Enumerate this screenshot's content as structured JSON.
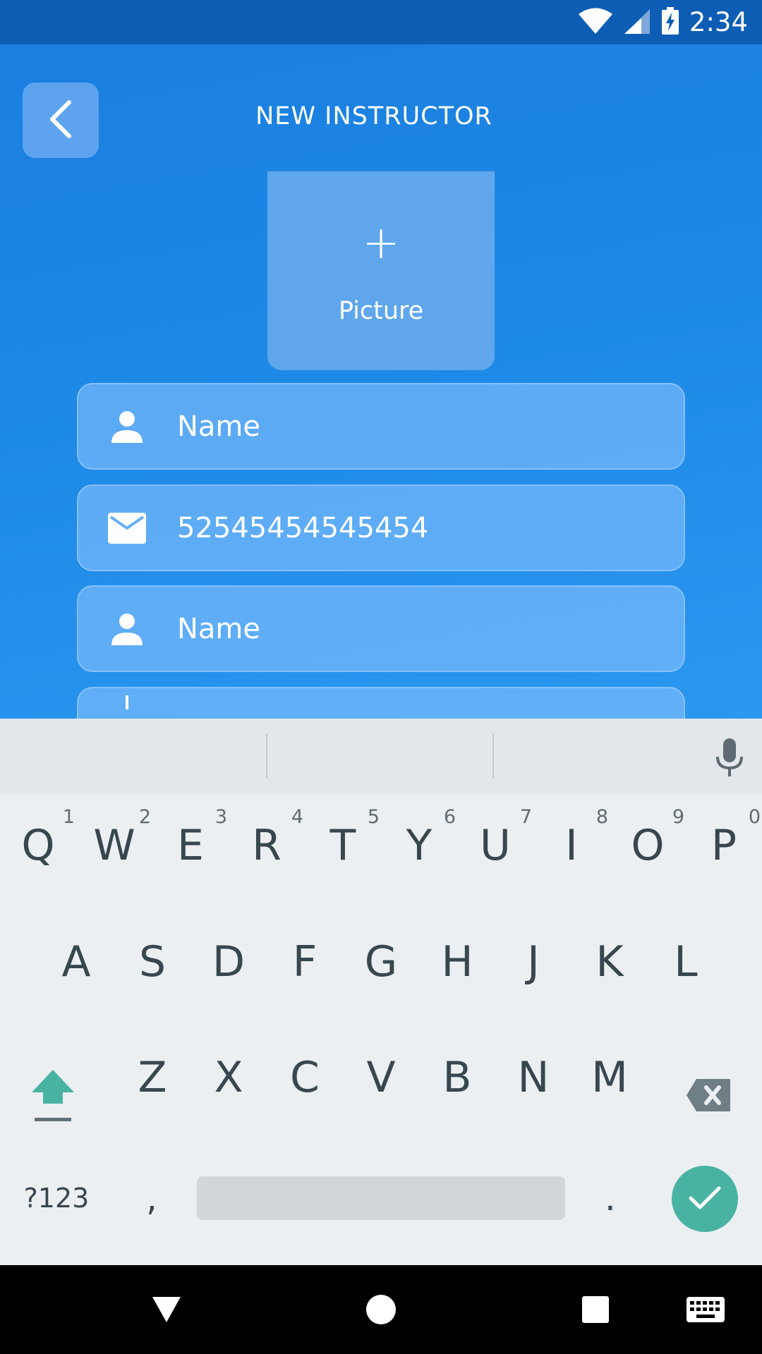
{
  "status_bar": {
    "time": "2:34",
    "icons": [
      "wifi-icon",
      "cell-signal-icon",
      "battery-charging-icon"
    ]
  },
  "header": {
    "title": "NEW INSTRUCTOR",
    "back_icon": "chevron-left-icon"
  },
  "picture": {
    "plus": "+",
    "label": "Picture"
  },
  "form": {
    "fields": [
      {
        "icon": "person-icon",
        "value": "",
        "placeholder": "Name"
      },
      {
        "icon": "mail-icon",
        "value": "52545454545454",
        "placeholder": ""
      },
      {
        "icon": "person-icon",
        "value": "",
        "placeholder": "Name"
      }
    ]
  },
  "keyboard": {
    "row1": [
      {
        "key": "Q",
        "hint": "1"
      },
      {
        "key": "W",
        "hint": "2"
      },
      {
        "key": "E",
        "hint": "3"
      },
      {
        "key": "R",
        "hint": "4"
      },
      {
        "key": "T",
        "hint": "5"
      },
      {
        "key": "Y",
        "hint": "6"
      },
      {
        "key": "U",
        "hint": "7"
      },
      {
        "key": "I",
        "hint": "8"
      },
      {
        "key": "O",
        "hint": "9"
      },
      {
        "key": "P",
        "hint": "0"
      }
    ],
    "row2": [
      "A",
      "S",
      "D",
      "F",
      "G",
      "H",
      "J",
      "K",
      "L"
    ],
    "row3": [
      "Z",
      "X",
      "C",
      "V",
      "B",
      "N",
      "M"
    ],
    "symbols_label": "?123",
    "comma": ",",
    "period": ".",
    "accent_color": "#48b3a3"
  },
  "nav_bar": {
    "icons": [
      "back-triangle-icon",
      "home-circle-icon",
      "recents-square-icon",
      "keyboard-switch-icon"
    ]
  }
}
